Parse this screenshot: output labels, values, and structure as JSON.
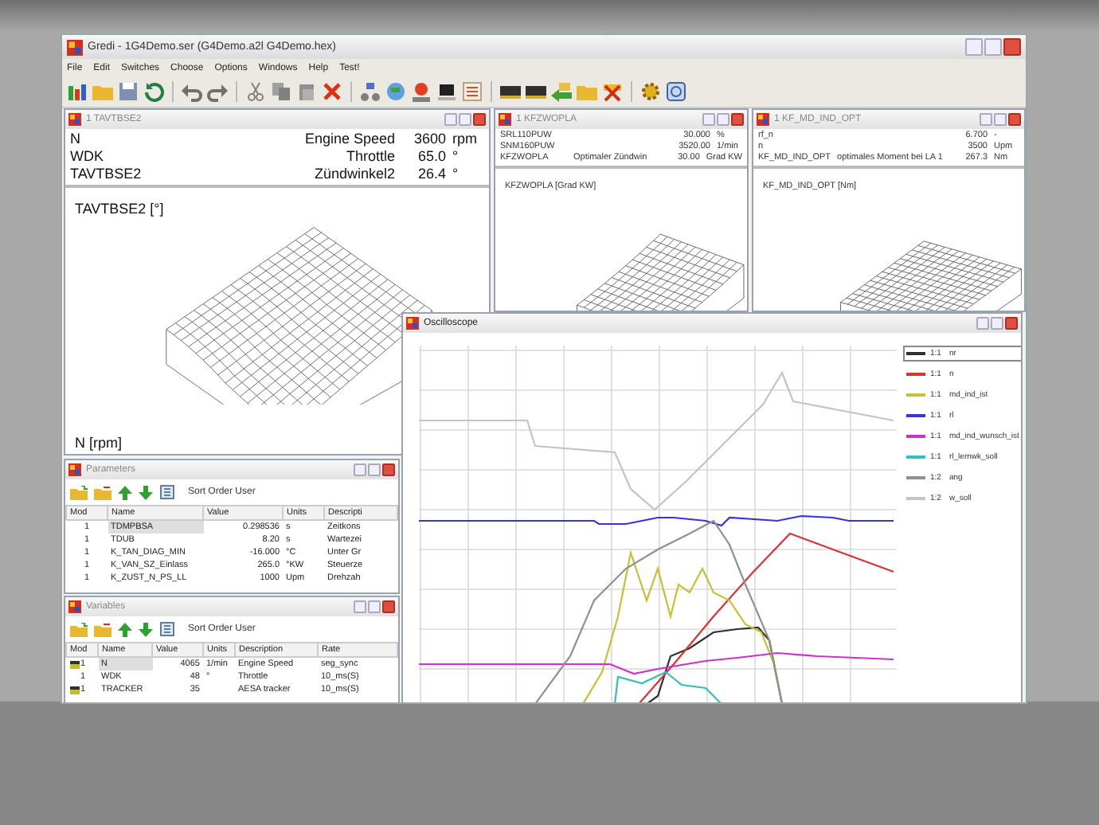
{
  "window": {
    "title": "Gredi - 1G4Demo.ser (G4Demo.a2l G4Demo.hex)"
  },
  "menu": [
    "File",
    "Edit",
    "Switches",
    "Choose",
    "Options",
    "Windows",
    "Help",
    "Test!"
  ],
  "map_windows": [
    {
      "kind": "large",
      "title": "1 TAVTBSE2",
      "plot_title": "TAVTBSE2 [°]",
      "axis_label": "N [rpm]",
      "rows": [
        {
          "name": "N",
          "description": "Engine Speed",
          "value": "3600",
          "unit": "rpm"
        },
        {
          "name": "WDK",
          "description": "Throttle",
          "value": "65.0",
          "unit": "°"
        },
        {
          "name": "TAVTBSE2",
          "description": "Zündwinkel2",
          "value": "26.4",
          "unit": "°"
        }
      ]
    },
    {
      "kind": "small",
      "title": "1 KFZWOPLA",
      "plot_title": "KFZWOPLA [Grad KW]",
      "rows": [
        {
          "name": "SRL110PUW",
          "description": "",
          "value": "30.000",
          "unit": "%"
        },
        {
          "name": "SNM160PUW",
          "description": "",
          "value": "3520.00",
          "unit": "1/min"
        },
        {
          "name": "KFZWOPLA",
          "description": "Optimaler Zündwin",
          "value": "30.00",
          "unit": "Grad KW"
        }
      ]
    },
    {
      "kind": "small",
      "title": "1 KF_MD_IND_OPT",
      "plot_title": "KF_MD_IND_OPT [Nm]",
      "rows": [
        {
          "name": "rf_n",
          "description": "",
          "value": "6.700",
          "unit": "-"
        },
        {
          "name": "n",
          "description": "",
          "value": "3500",
          "unit": "Upm"
        },
        {
          "name": "KF_MD_IND_OPT",
          "description": "optimales Moment bei LA 1",
          "value": "267.3",
          "unit": "Nm"
        }
      ]
    }
  ],
  "parameters": {
    "title": "Parameters",
    "sort_label": "Sort Order User",
    "columns": [
      "Mod",
      "Name",
      "Value",
      "Units",
      "Descripti"
    ],
    "rows": [
      {
        "mod": "1",
        "name": "TDMPBSA",
        "value": "0.298536",
        "units": "s",
        "description": "Zeitkons",
        "selected": true
      },
      {
        "mod": "1",
        "name": "TDUB",
        "value": "8.20",
        "units": "s",
        "description": "Wartezei",
        "selected": false
      },
      {
        "mod": "1",
        "name": "K_TAN_DIAG_MIN",
        "value": "-16.000",
        "units": "°C",
        "description": "Unter Gr",
        "selected": false
      },
      {
        "mod": "1",
        "name": "K_VAN_SZ_Einlass",
        "value": "265.0",
        "units": "°KW",
        "description": "Steuerze",
        "selected": false
      },
      {
        "mod": "1",
        "name": "K_ZUST_N_PS_LL",
        "value": "1000",
        "units": "Upm",
        "description": "Drehzah",
        "selected": false
      }
    ]
  },
  "variables": {
    "title": "Variables",
    "sort_label": "Sort Order User",
    "columns": [
      "Mod",
      "Name",
      "Value",
      "Units",
      "Description",
      "Rate"
    ],
    "rows": [
      {
        "mod": "1",
        "name": "N",
        "value": "4065",
        "units": "1/min",
        "description": "Engine Speed",
        "rate": "seg_sync",
        "selected": true,
        "recorded": true
      },
      {
        "mod": "1",
        "name": "WDK",
        "value": "48",
        "units": "°",
        "description": "Throttle",
        "rate": "10_ms(S)",
        "selected": false,
        "recorded": false
      },
      {
        "mod": "1",
        "name": "TRACKER",
        "value": "35",
        "units": "",
        "description": "AESA tracker",
        "rate": "10_ms(S)",
        "selected": false,
        "recorded": true
      }
    ]
  },
  "oscilloscope": {
    "title": "Oscilloscope",
    "legend": [
      {
        "scale": "1:1",
        "name": "nr",
        "color": "#303030",
        "selected": true
      },
      {
        "scale": "1:1",
        "name": "n",
        "color": "#e03030",
        "selected": false
      },
      {
        "scale": "1:1",
        "name": "md_ind_ist",
        "color": "#c8c030",
        "selected": false
      },
      {
        "scale": "1:1",
        "name": "rl",
        "color": "#3434e0",
        "selected": false
      },
      {
        "scale": "1:1",
        "name": "md_ind_wunsch_ist",
        "color": "#d030d0",
        "selected": false
      },
      {
        "scale": "1:1",
        "name": "rl_lernwk_soll",
        "color": "#30c0c0",
        "selected": false
      },
      {
        "scale": "1:2",
        "name": "ang",
        "color": "#909090",
        "selected": false
      },
      {
        "scale": "1:2",
        "name": "w_soll",
        "color": "#c4c4c4",
        "selected": false
      }
    ]
  }
}
